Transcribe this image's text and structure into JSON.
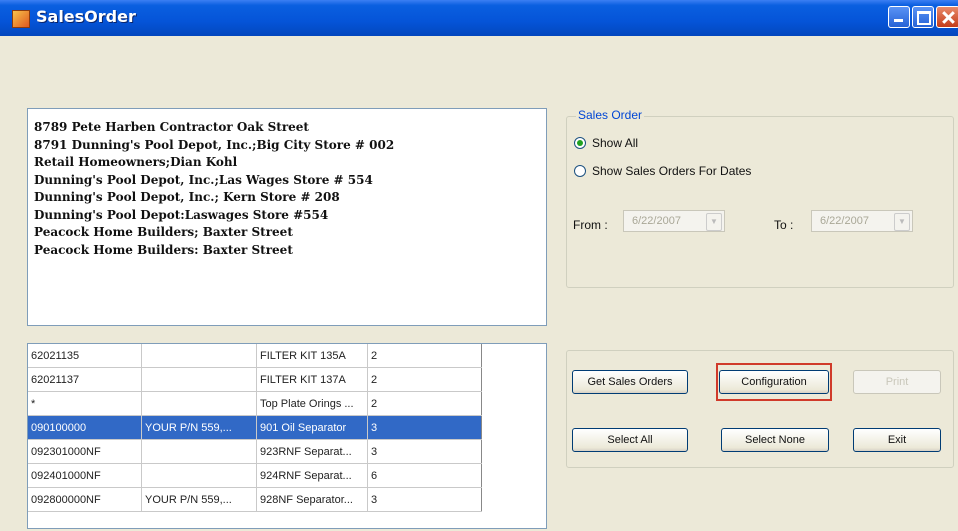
{
  "window": {
    "title": "SalesOrder"
  },
  "customers": [
    "8789  Pete Harben Contractor Oak Street",
    "8791  Dunning's Pool Depot, Inc.;Big City Store # 002",
    "Retail Homeowners;Dian Kohl",
    "Dunning's Pool Depot, Inc.;Las Wages Store # 554",
    "Dunning's Pool Depot, Inc.; Kern Store # 208",
    "Dunning's Pool Depot:Laswages Store #554",
    "Peacock Home Builders; Baxter Street",
    "Peacock Home Builders: Baxter Street"
  ],
  "items": [
    {
      "item": "62021135",
      "desc": "",
      "name": "FILTER KIT 135A",
      "qty": "2"
    },
    {
      "item": "62021137",
      "desc": "",
      "name": "FILTER KIT 137A",
      "qty": "2"
    },
    {
      "item": "*",
      "desc": "",
      "name": "Top Plate Orings ...",
      "qty": "2"
    },
    {
      "item": "090100000",
      "desc": "YOUR P/N 559,...",
      "name": "901 Oil Separator",
      "qty": "3"
    },
    {
      "item": "092301000NF",
      "desc": "",
      "name": "923RNF Separat...",
      "qty": "3"
    },
    {
      "item": "092401000NF",
      "desc": "",
      "name": "924RNF Separat...",
      "qty": "6"
    },
    {
      "item": "092800000NF",
      "desc": "YOUR P/N 559,...",
      "name": "928NF Separator...",
      "qty": "3"
    }
  ],
  "sales_order": {
    "legend": "Sales Order",
    "show_all": "Show All",
    "show_for_dates": "Show Sales Orders For Dates",
    "from_label": "From :",
    "from_value": "6/22/2007",
    "to_label": "To :",
    "to_value": "6/22/2007"
  },
  "buttons": {
    "get_sales_orders": "Get Sales Orders",
    "configuration": "Configuration",
    "print": "Print",
    "select_all": "Select All",
    "select_none": "Select None",
    "exit": "Exit"
  }
}
